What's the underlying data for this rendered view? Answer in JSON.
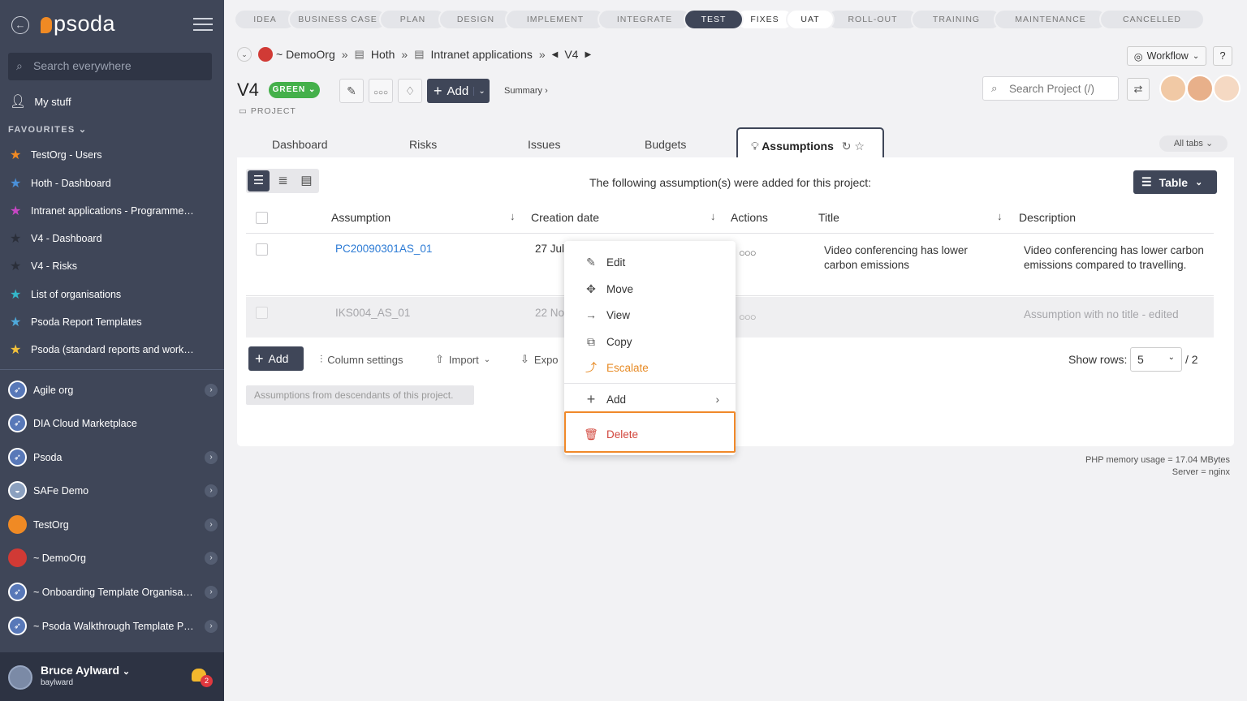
{
  "sidebar": {
    "logo": "psoda",
    "search_placeholder": "Search everywhere",
    "my_stuff": "My stuff",
    "favourites_heading": "FAVOURITES",
    "favourites": [
      {
        "label": "TestOrg - Users",
        "color": "#f08a24"
      },
      {
        "label": "Hoth - Dashboard",
        "color": "#4a90d9"
      },
      {
        "label": "Intranet applications - Programme…",
        "color": "#c747c4"
      },
      {
        "label": "V4 - Dashboard",
        "color": "#2b2f3a"
      },
      {
        "label": "V4 - Risks",
        "color": "#2b2f3a"
      },
      {
        "label": "List of organisations",
        "color": "#34b7c9"
      },
      {
        "label": "Psoda Report Templates",
        "color": "#4fa9db"
      },
      {
        "label": "Psoda (standard reports and work…",
        "color": "#f3c13a"
      }
    ],
    "orgs": [
      {
        "label": "Agile org",
        "color": "#5878b8",
        "icon": "compass-icon"
      },
      {
        "label": "DIA Cloud Marketplace",
        "color": "#5878b8",
        "icon": "compass-icon"
      },
      {
        "label": "Psoda",
        "color": "#5878b8",
        "icon": "compass-icon"
      },
      {
        "label": "SAFe Demo",
        "color": "#8ba0bf",
        "icon": "globe-icon"
      },
      {
        "label": "TestOrg",
        "color": "#f08a24",
        "icon": "org-icon"
      },
      {
        "label": "~ DemoOrg",
        "color": "#d13a35",
        "icon": "org-icon"
      },
      {
        "label": "~ Onboarding Template Organisa…",
        "color": "#5878b8",
        "icon": "compass-icon"
      },
      {
        "label": "~ Psoda Walkthrough Template P…",
        "color": "#5878b8",
        "icon": "compass-icon"
      }
    ],
    "user": {
      "name": "Bruce Aylward",
      "login": "baylward",
      "notifications": "2"
    }
  },
  "phases": [
    {
      "label": "IDEA",
      "state": "normal"
    },
    {
      "label": "BUSINESS CASE",
      "state": "normal"
    },
    {
      "label": "PLAN",
      "state": "normal"
    },
    {
      "label": "DESIGN",
      "state": "normal"
    },
    {
      "label": "IMPLEMENT",
      "state": "normal"
    },
    {
      "label": "INTEGRATE",
      "state": "normal"
    },
    {
      "label": "TEST",
      "state": "active"
    },
    {
      "label": "FIXES",
      "state": "white"
    },
    {
      "label": "UAT",
      "state": "white"
    },
    {
      "label": "ROLL-OUT",
      "state": "normal"
    },
    {
      "label": "TRAINING",
      "state": "normal"
    },
    {
      "label": "MAINTENANCE",
      "state": "normal"
    },
    {
      "label": "CANCELLED",
      "state": "normal"
    }
  ],
  "breadcrumb": {
    "org": "~ DemoOrg",
    "programme": "Hoth",
    "project_group": "Intranet applications",
    "current": "V4"
  },
  "header": {
    "title": "V4",
    "status": "GREEN",
    "type_label": "PROJECT",
    "add_label": "Add",
    "summary_label": "Summary ›",
    "workflow_label": "Workflow",
    "help_label": "?",
    "search_placeholder": "Search Project (/)"
  },
  "tabs": [
    {
      "label": "Dashboard"
    },
    {
      "label": "Risks"
    },
    {
      "label": "Issues"
    },
    {
      "label": "Budgets"
    },
    {
      "label": "Assumptions"
    }
  ],
  "all_tabs_label": "All tabs",
  "content": {
    "intro": "The following assumption(s) were added for this project:",
    "view_label": "Table",
    "columns": {
      "assumption": "Assumption",
      "creation_date": "Creation date",
      "actions": "Actions",
      "title": "Title",
      "description": "Description"
    },
    "rows": [
      {
        "id": "PC20090301AS_01",
        "date": "27 Jul",
        "title": "Video conferencing has lower carbon emissions",
        "description": "Video conferencing has lower carbon emissions compared to travelling."
      },
      {
        "id": "IKS004_AS_01",
        "date": "22 No",
        "title": "",
        "description": "Assumption with no title - edited"
      }
    ],
    "footer": {
      "add_label": "Add",
      "column_settings": "Column settings",
      "import_label": "Import",
      "export_label": "Expo",
      "show_rows_label": "Show rows:",
      "rows_value": "5",
      "total": "/ 2",
      "descendants_label": "Assumptions from descendants of this project."
    }
  },
  "context_menu": {
    "edit": "Edit",
    "move": "Move",
    "view": "View",
    "copy": "Copy",
    "escalate": "Escalate",
    "add": "Add",
    "delete": "Delete"
  },
  "server_info": {
    "memory": "PHP memory usage = 17.04 MBytes",
    "server": "Server = nginx"
  }
}
